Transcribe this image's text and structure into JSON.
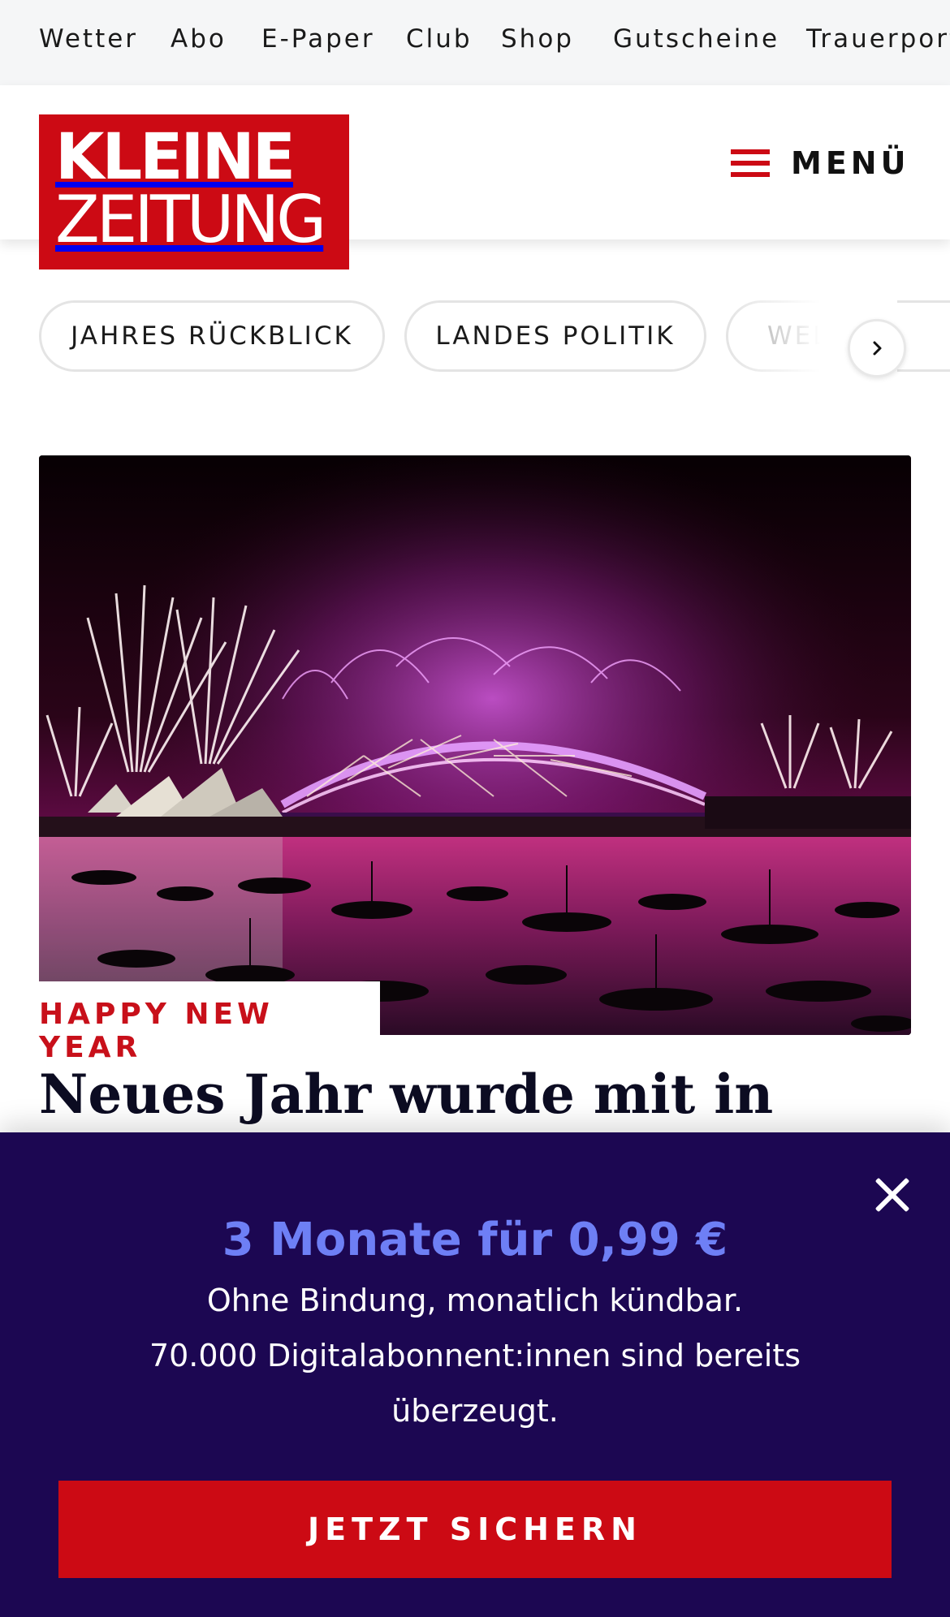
{
  "topnav": {
    "items": [
      "Wetter",
      "Abo",
      "E-Paper",
      "Club",
      "Shop",
      "Gutscheine",
      "Trauerportal"
    ]
  },
  "header": {
    "logo_line1": "KLEINE",
    "logo_line2": "ZEITUNG",
    "menu_label": "MENÜ",
    "menu_icon": "hamburger-icon"
  },
  "topics": {
    "chips": [
      "JAHRES RÜCKBLICK",
      "LANDES POLITIK",
      "WELT"
    ],
    "next_icon": "chevron-right-icon"
  },
  "article": {
    "image_subject": "fireworks-harbour",
    "kicker": "HAPPY NEW YEAR",
    "headline": "Neues Jahr wurde mit in"
  },
  "paywall": {
    "offer": "3 Monate für 0,99 €",
    "line1": "Ohne Bindung, monatlich kündbar.",
    "line2": "70.000 Digitalabonnent:innen sind bereits",
    "line3": "überzeugt.",
    "cta": "JETZT SICHERN",
    "close_icon": "close-icon"
  },
  "colors": {
    "brand_red": "#cc0a14",
    "paywall_bg": "#1c0752",
    "offer_accent": "#6e7ff5",
    "kicker_red": "#c8101a"
  }
}
